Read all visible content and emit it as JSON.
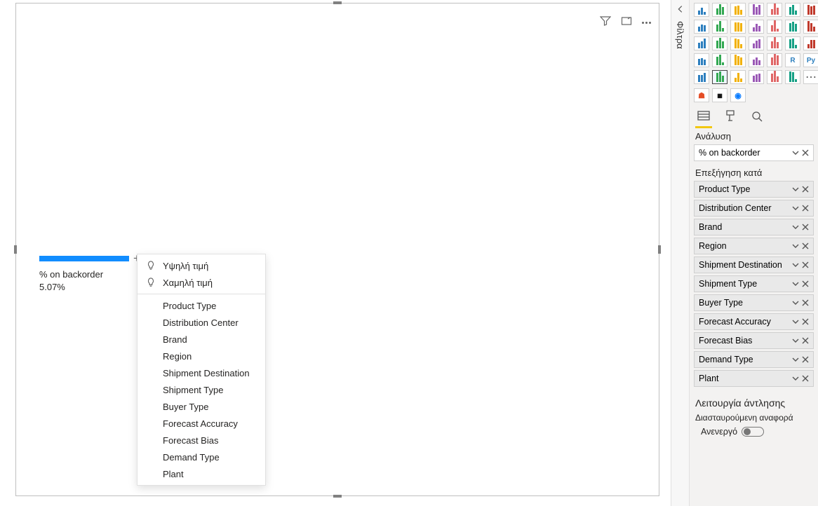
{
  "canvas": {
    "bar_label": "% on backorder",
    "bar_value": "5.07%",
    "plus_glyph": "+"
  },
  "context_menu": {
    "hint_high": "Υψηλή τιμή",
    "hint_low": "Χαμηλή τιμή",
    "items": [
      "Product Type",
      "Distribution Center",
      "Brand",
      "Region",
      "Shipment Destination",
      "Shipment Type",
      "Buyer Type",
      "Forecast Accuracy",
      "Forecast Bias",
      "Demand Type",
      "Plant"
    ]
  },
  "filter_rail": {
    "label": "Φίλτρα"
  },
  "pane": {
    "tab_label": "Ανάλυση",
    "slot_value": "% on backorder",
    "explain_label": "Επεξήγηση κατά",
    "chips": [
      "Product Type",
      "Distribution Center",
      "Brand",
      "Region",
      "Shipment Destination",
      "Shipment Type",
      "Buyer Type",
      "Forecast Accuracy",
      "Forecast Bias",
      "Demand Type",
      "Plant"
    ],
    "drill_heading": "Λειτουργία άντλησης",
    "drill_sub": "Διασταυρούμενη αναφορά",
    "toggle_label": "Ανενεργό"
  },
  "viz_gallery": {
    "count": 35,
    "selected_index": 29,
    "text_tiles": {
      "26": "R",
      "27": "Py"
    }
  },
  "chart_data": {
    "type": "bar",
    "title": "% on backorder",
    "categories": [
      "% on backorder"
    ],
    "values": [
      5.07
    ],
    "xlabel": "",
    "ylabel": "",
    "xlim": [
      0,
      100
    ]
  }
}
